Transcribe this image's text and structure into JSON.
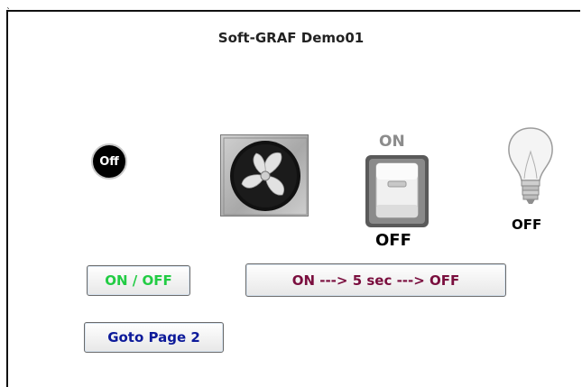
{
  "title": "Soft-GRAF  Demo01",
  "corner_mark": "`",
  "indicator": {
    "label": "Off"
  },
  "fan": {
    "icon": "fan-icon"
  },
  "switch": {
    "on_label": "ON",
    "off_label": "OFF",
    "icon": "toggle-switch-icon"
  },
  "bulb": {
    "label": "OFF",
    "icon": "light-bulb-icon"
  },
  "buttons": {
    "on_off": "ON / OFF",
    "timer": "ON ---> 5 sec ---> OFF",
    "goto": "Goto Page 2"
  },
  "colors": {
    "on_off_text": "#22cc44",
    "timer_text": "#7a0e3e",
    "goto_text": "#0d1a9a"
  }
}
